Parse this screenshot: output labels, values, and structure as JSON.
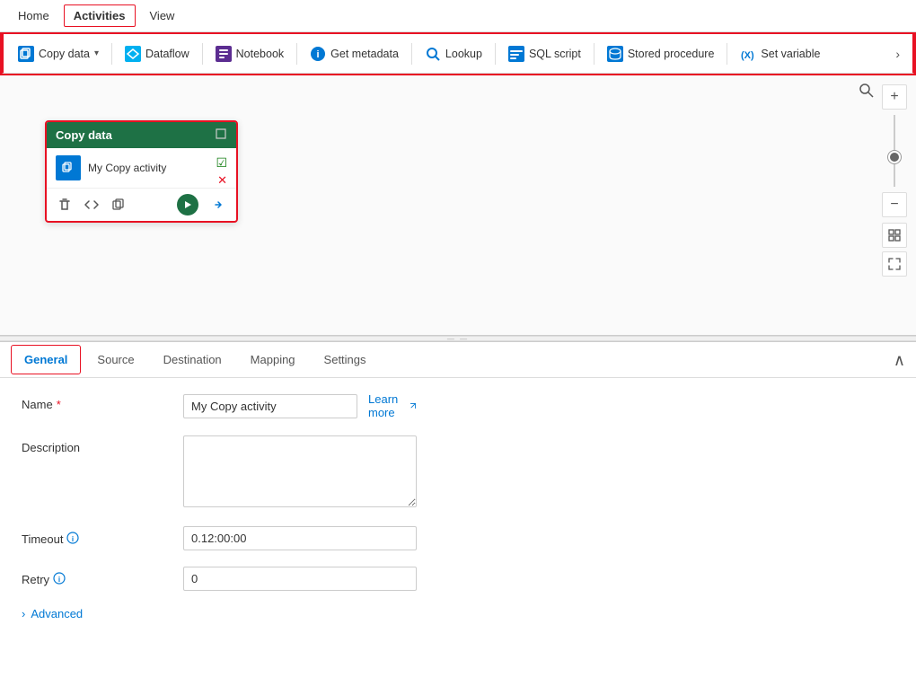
{
  "nav": {
    "items": [
      {
        "id": "home",
        "label": "Home",
        "active": false
      },
      {
        "id": "activities",
        "label": "Activities",
        "active": true
      },
      {
        "id": "view",
        "label": "View",
        "active": false
      }
    ]
  },
  "toolbar": {
    "items": [
      {
        "id": "copy-data",
        "label": "Copy data",
        "has_dropdown": true,
        "icon": "copy-data-icon"
      },
      {
        "id": "dataflow",
        "label": "Dataflow",
        "has_dropdown": false,
        "icon": "dataflow-icon"
      },
      {
        "id": "notebook",
        "label": "Notebook",
        "has_dropdown": false,
        "icon": "notebook-icon"
      },
      {
        "id": "get-metadata",
        "label": "Get metadata",
        "has_dropdown": false,
        "icon": "info-icon"
      },
      {
        "id": "lookup",
        "label": "Lookup",
        "has_dropdown": false,
        "icon": "lookup-icon"
      },
      {
        "id": "sql-script",
        "label": "SQL script",
        "has_dropdown": false,
        "icon": "sql-icon"
      },
      {
        "id": "stored-procedure",
        "label": "Stored procedure",
        "has_dropdown": false,
        "icon": "stored-icon"
      },
      {
        "id": "set-variable",
        "label": "Set variable",
        "has_dropdown": false,
        "icon": "setvar-icon"
      }
    ],
    "more_label": "›"
  },
  "canvas": {
    "activity_card": {
      "header": "Copy data",
      "name": "My Copy activity",
      "status_check": "✓",
      "status_x": "✗"
    }
  },
  "bottom_panel": {
    "tabs": [
      {
        "id": "general",
        "label": "General",
        "active": true
      },
      {
        "id": "source",
        "label": "Source",
        "active": false
      },
      {
        "id": "destination",
        "label": "Destination",
        "active": false
      },
      {
        "id": "mapping",
        "label": "Mapping",
        "active": false
      },
      {
        "id": "settings",
        "label": "Settings",
        "active": false
      }
    ],
    "form": {
      "name_label": "Name",
      "name_required": "*",
      "name_value": "My Copy activity",
      "learn_more": "Learn more",
      "description_label": "Description",
      "description_placeholder": "",
      "timeout_label": "Timeout",
      "timeout_value": "0.12:00:00",
      "retry_label": "Retry",
      "retry_value": "0",
      "advanced_label": "Advanced"
    }
  }
}
